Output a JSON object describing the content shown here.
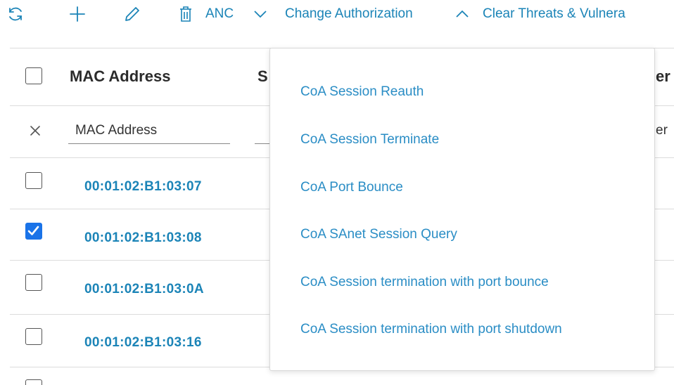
{
  "toolbar": {
    "refresh_icon": "refresh-icon",
    "add_icon": "plus-icon",
    "edit_icon": "pencil-icon",
    "delete_icon": "trash-icon",
    "anc_label": "ANC",
    "change_authorization_label": "Change Authorization",
    "clear_threats_label": "Clear Threats & Vulnera"
  },
  "table": {
    "header": {
      "mac_address": "MAC Address",
      "second_col_fragment": "S",
      "right_col_fragment": "er"
    },
    "filter": {
      "clear_icon": "close-icon",
      "mac_placeholder": "MAC Address",
      "right_fragment": "er"
    },
    "rows": [
      {
        "mac": "00:01:02:B1:03:07",
        "checked": false
      },
      {
        "mac": "00:01:02:B1:03:08",
        "checked": true
      },
      {
        "mac": "00:01:02:B1:03:0A",
        "checked": false
      },
      {
        "mac": "00:01:02:B1:03:16",
        "checked": false
      }
    ]
  },
  "dropdown": {
    "items": [
      "CoA Session Reauth",
      "CoA Session Terminate",
      "CoA Port Bounce",
      "CoA SAnet Session Query",
      "CoA Session termination with port bounce",
      "CoA Session termination with port shutdown"
    ]
  },
  "colors": {
    "link": "#1b84b7",
    "menu_link": "#2a8dc5",
    "checkbox_checked": "#1a73e8"
  }
}
